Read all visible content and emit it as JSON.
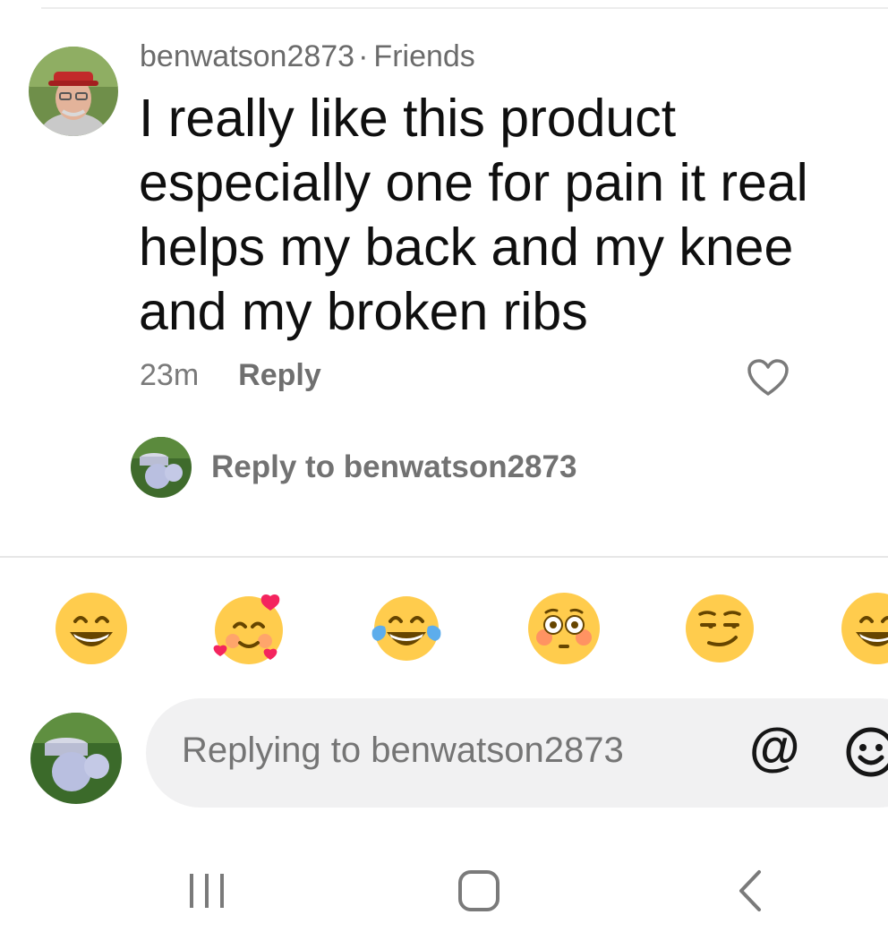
{
  "comment": {
    "username": "benwatson2873",
    "separator": "·",
    "relation": "Friends",
    "text": "I really like this product\nespecially one for pain it real\nhelps my back and my knee\nand my broken ribs",
    "time": "23m",
    "reply_label": "Reply",
    "like_icon": "heart-outline-icon"
  },
  "reply_prompt": {
    "text": "Reply to benwatson2873"
  },
  "emoji_bar": {
    "items": [
      "grinning-face",
      "smiling-face-with-hearts",
      "face-with-tears-of-joy",
      "flushed-face",
      "smirking-face",
      "grinning-face"
    ]
  },
  "composer": {
    "placeholder": "Replying to benwatson2873",
    "mention_symbol": "@",
    "emoji_icon": "smiley-outline-icon"
  },
  "nav": {
    "recent": "recent-apps-icon",
    "home": "home-icon",
    "back": "back-icon"
  },
  "colors": {
    "text_primary": "#0f0f0f",
    "text_secondary": "#6b6b6b",
    "input_bg": "#f1f1f2",
    "emoji_yellow": "#ffcc4d"
  }
}
